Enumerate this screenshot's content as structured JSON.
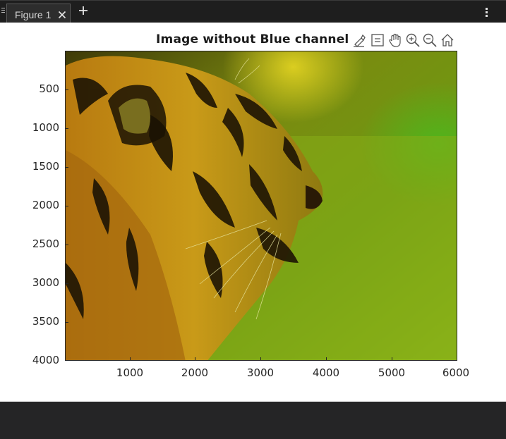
{
  "tab": {
    "label": "Figure 1",
    "close_icon": "close-icon",
    "add_icon": "plus-icon"
  },
  "menu_icon": "kebab-menu-icon",
  "plot": {
    "title": "Image without Blue channel",
    "image_subject": "tiger",
    "y_ticks": [
      "500",
      "1000",
      "1500",
      "2000",
      "2500",
      "3000",
      "3500",
      "4000"
    ],
    "x_ticks": [
      "1000",
      "2000",
      "3000",
      "4000",
      "5000",
      "6000"
    ]
  },
  "toolbar": {
    "icons": [
      "brush-icon",
      "datatip-icon",
      "pan-hand-icon",
      "zoom-in-icon",
      "zoom-out-icon",
      "home-icon"
    ]
  },
  "colors": {
    "tab_bg": "#2d2d2d",
    "tabbar_bg": "#1e1e1e",
    "figure_bg": "#ffffff",
    "panel_bg": "#252526"
  }
}
